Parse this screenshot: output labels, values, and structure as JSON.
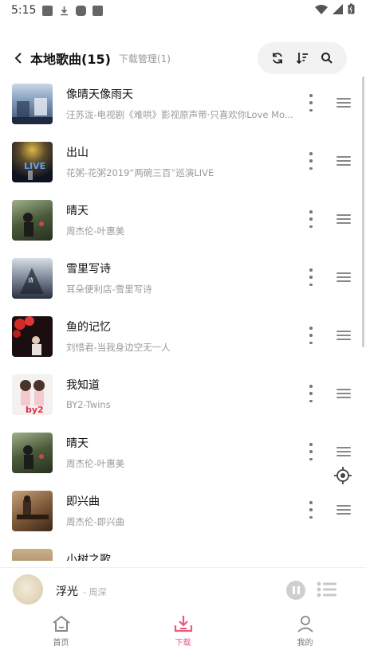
{
  "status_bar": {
    "time": "5:15"
  },
  "header": {
    "title": "本地歌曲(15)",
    "subtitle": "下载管理(1)",
    "icons": [
      "refresh-icon",
      "sort-icon",
      "search-icon"
    ]
  },
  "songs": [
    {
      "title": "像晴天像雨天",
      "subtitle": "汪苏泷-电视剧《难哄》影视原声带·只喜欢你Love Mo..."
    },
    {
      "title": "出山",
      "subtitle": "花粥-花粥2019“两碗三百”巡演LIVE"
    },
    {
      "title": "晴天",
      "subtitle": "周杰伦-叶惠美"
    },
    {
      "title": "雪里写诗",
      "subtitle": "耳朵便利店-雪里写诗"
    },
    {
      "title": "鱼的记忆",
      "subtitle": "刘惜君-当我身边空无一人"
    },
    {
      "title": "我知道",
      "subtitle": "BY2-Twins"
    },
    {
      "title": "晴天",
      "subtitle": "周杰伦-叶惠美"
    },
    {
      "title": "即兴曲",
      "subtitle": "周杰伦-即兴曲"
    },
    {
      "title": "小树之歌",
      "subtitle": ""
    }
  ],
  "player": {
    "title": "浮光",
    "artist": "- 周深"
  },
  "nav": [
    {
      "label": "首页",
      "icon": "home-icon"
    },
    {
      "label": "下载",
      "icon": "download-icon",
      "active": true
    },
    {
      "label": "我的",
      "icon": "profile-icon"
    }
  ],
  "colors": {
    "accent": "#ea5b7f",
    "muted": "#9a9a9a"
  }
}
